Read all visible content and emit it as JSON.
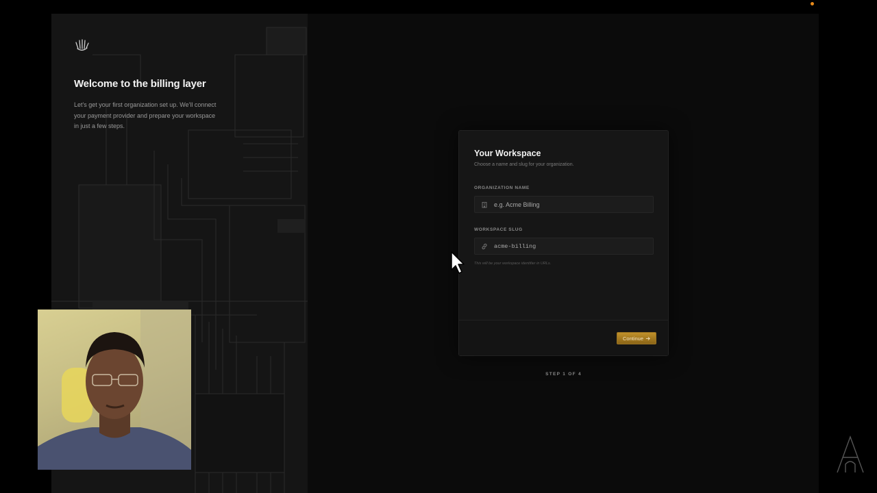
{
  "welcome": {
    "title": "Welcome to the billing layer",
    "body": "Let's get your first organization set up. We'll connect your payment provider and prepare your workspace in just a few steps."
  },
  "workspace_card": {
    "title": "Your Workspace",
    "subtitle": "Choose a name and slug for your organization.",
    "org_name": {
      "label": "ORGANIZATION NAME",
      "placeholder": "e.g. Acme Billing",
      "value": "",
      "icon": "building-icon"
    },
    "slug": {
      "label": "WORKSPACE SLUG",
      "placeholder": "acme-billing",
      "value": "",
      "icon": "link-icon",
      "help": "This will be your workspace identifier in URLs."
    },
    "continue_label": "Continue"
  },
  "step_indicator": "STEP 1 OF 4",
  "colors": {
    "accent": "#c0902a",
    "background": "#0b0b0b",
    "card": "#161616",
    "status_dot": "#e88a1a"
  },
  "icons": [
    "hand-logo-icon",
    "building-icon",
    "link-icon",
    "arrow-right-icon",
    "mouse-cursor-icon",
    "a-monogram-icon"
  ]
}
